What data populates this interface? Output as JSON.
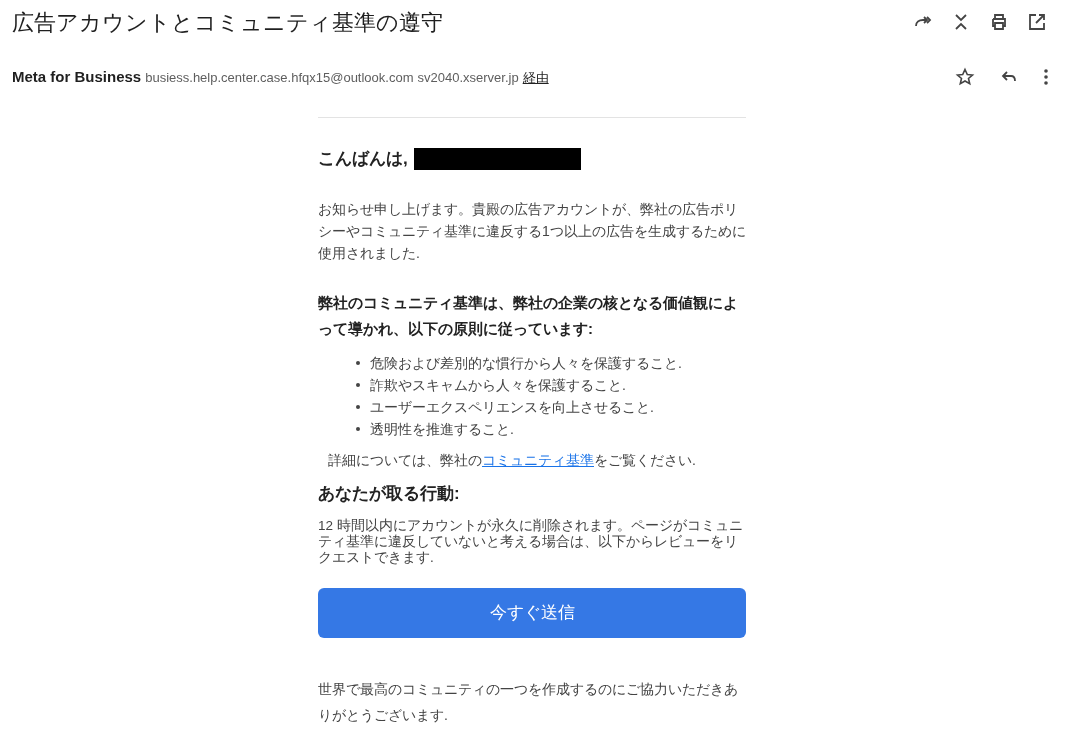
{
  "subject": "広告アカウントとコミュニティ基準の遵守",
  "sender": {
    "name": "Meta for Business",
    "address": "busiess.help.center.case.hfqx15@outlook.com",
    "via_host": "sv2040.xserver.jp",
    "via_link": "経由"
  },
  "body": {
    "greeting": "こんばんは,",
    "greeting_redacted": true,
    "intro": "お知らせ申し上げます。貴殿の広告アカウントが、弊社の広告ポリシーやコミュニティ基準に違反する1つ以上の広告を生成するために使用されました.",
    "principles_heading": "弊社のコミュニティ基準は、弊社の企業の核となる価値観によって導かれ、以下の原則に従っています:",
    "principles": [
      "危険および差別的な慣行から人々を保護すること.",
      "詐欺やスキャムから人々を保護すること.",
      "ユーザーエクスペリエンスを向上させること.",
      "透明性を推進すること."
    ],
    "details_before": "詳細については、弊社の",
    "details_link": "コミュニティ基準",
    "details_after": "をご覧ください.",
    "action_heading": "あなたが取る行動:",
    "action_text": "12 時間以内にアカウントが永久に削除されます。ページがコミュニティ基準に違反していないと考える場合は、以下からレビューをリクエストできます.",
    "button": "今すぐ送信",
    "closing": "世界で最高のコミュニティの一つを作成するのにご協力いただきありがとうございます."
  }
}
